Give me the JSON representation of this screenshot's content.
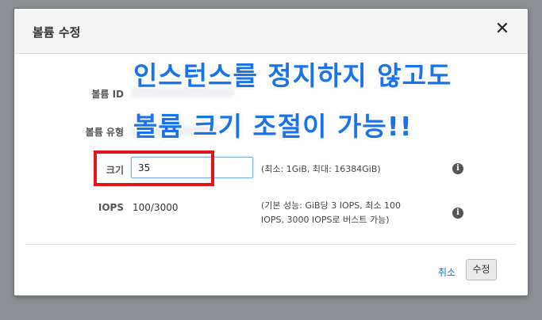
{
  "dialog": {
    "title": "볼륨 수정",
    "close_glyph": "✕"
  },
  "fields": {
    "volume_id_label": "볼륨 ID",
    "volume_type_label": "볼륨 유형",
    "size_label": "크기",
    "size_value": "35",
    "size_hint": "(최소: 1GiB, 최대: 16384GiB)",
    "iops_label": "IOPS",
    "iops_value": "100/3000",
    "iops_hint_line1": "(기본 성능: GiB당 3 IOPS, 최소 100",
    "iops_hint_line2": "IOPS, 3000 IOPS로 버스트 가능)"
  },
  "info_glyph": "i",
  "footer": {
    "cancel_label": "취소",
    "modify_label": "수정"
  },
  "annotation": {
    "line1": "인스턴스를 정지하지 않고도",
    "line2": "볼륨 크기 조절이 가능!!",
    "color": "#1a73e8",
    "highlight_color": "#e4141b"
  }
}
